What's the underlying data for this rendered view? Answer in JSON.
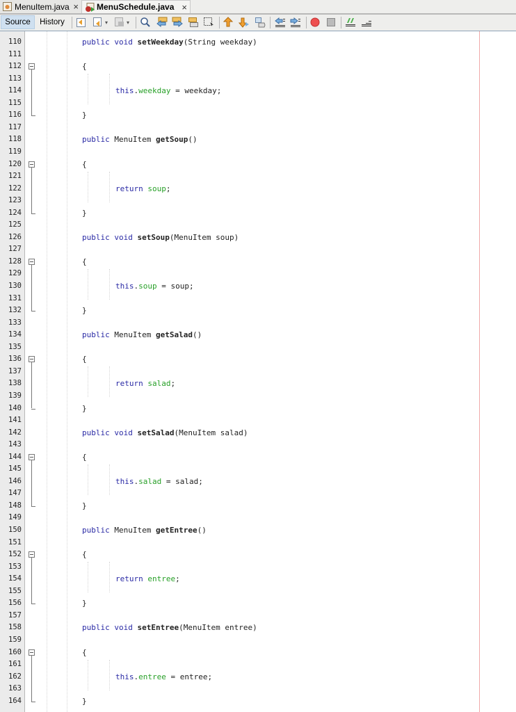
{
  "tabs": [
    {
      "label": "MenuItem.java",
      "icon": "java-file-icon",
      "close": "×",
      "active": false
    },
    {
      "label": "MenuSchedule.java",
      "icon": "java-main-file-icon",
      "close": "×",
      "active": true
    }
  ],
  "toolbar": {
    "source_label": "Source",
    "history_label": "History",
    "icons": [
      "last-edit-icon",
      "back-icon",
      "forward-icon",
      "find-selection-icon",
      "find-previous-icon",
      "find-next-icon",
      "toggle-highlight-icon",
      "toggle-rectangular-selection-icon",
      "previous-bookmark-icon",
      "next-bookmark-icon",
      "toggle-bookmark-icon",
      "shift-left-icon",
      "shift-right-icon",
      "start-macro-icon",
      "stop-macro-icon",
      "comment-icon",
      "uncomment-icon"
    ]
  },
  "colors": {
    "keyword": "#2a2aa5",
    "field": "#28a028",
    "margin_line": "#f0a9a9",
    "active_tab": "#cfe0f0"
  },
  "code": {
    "first_line": 110,
    "lines": [
      {
        "n": "110",
        "tokens": [
          [
            "kw",
            "public"
          ],
          [
            "t",
            " "
          ],
          [
            "kw",
            "void"
          ],
          [
            "t",
            " "
          ],
          [
            "m",
            "setWeekday"
          ],
          [
            "t",
            "(String weekday)"
          ]
        ]
      },
      {
        "n": "111",
        "tokens": []
      },
      {
        "n": "112",
        "tokens": [
          [
            "t",
            "{"
          ]
        ],
        "fold": "start"
      },
      {
        "n": "113",
        "tokens": []
      },
      {
        "n": "114",
        "indent": 1,
        "tokens": [
          [
            "kw",
            "this"
          ],
          [
            "t",
            "."
          ],
          [
            "f",
            "weekday"
          ],
          [
            "t",
            " = weekday;"
          ]
        ]
      },
      {
        "n": "115",
        "tokens": []
      },
      {
        "n": "116",
        "tokens": [
          [
            "t",
            "}"
          ]
        ],
        "fold": "end"
      },
      {
        "n": "117",
        "tokens": []
      },
      {
        "n": "118",
        "tokens": [
          [
            "kw",
            "public"
          ],
          [
            "t",
            " MenuItem "
          ],
          [
            "m",
            "getSoup"
          ],
          [
            "t",
            "()"
          ]
        ]
      },
      {
        "n": "119",
        "tokens": []
      },
      {
        "n": "120",
        "tokens": [
          [
            "t",
            "{"
          ]
        ],
        "fold": "start"
      },
      {
        "n": "121",
        "tokens": []
      },
      {
        "n": "122",
        "indent": 1,
        "tokens": [
          [
            "kw",
            "return"
          ],
          [
            "t",
            " "
          ],
          [
            "f",
            "soup"
          ],
          [
            "t",
            ";"
          ]
        ]
      },
      {
        "n": "123",
        "tokens": []
      },
      {
        "n": "124",
        "tokens": [
          [
            "t",
            "}"
          ]
        ],
        "fold": "end"
      },
      {
        "n": "125",
        "tokens": []
      },
      {
        "n": "126",
        "tokens": [
          [
            "kw",
            "public"
          ],
          [
            "t",
            " "
          ],
          [
            "kw",
            "void"
          ],
          [
            "t",
            " "
          ],
          [
            "m",
            "setSoup"
          ],
          [
            "t",
            "(MenuItem soup)"
          ]
        ]
      },
      {
        "n": "127",
        "tokens": []
      },
      {
        "n": "128",
        "tokens": [
          [
            "t",
            "{"
          ]
        ],
        "fold": "start"
      },
      {
        "n": "129",
        "tokens": []
      },
      {
        "n": "130",
        "indent": 1,
        "tokens": [
          [
            "kw",
            "this"
          ],
          [
            "t",
            "."
          ],
          [
            "f",
            "soup"
          ],
          [
            "t",
            " = soup;"
          ]
        ]
      },
      {
        "n": "131",
        "tokens": []
      },
      {
        "n": "132",
        "tokens": [
          [
            "t",
            "}"
          ]
        ],
        "fold": "end"
      },
      {
        "n": "133",
        "tokens": []
      },
      {
        "n": "134",
        "tokens": [
          [
            "kw",
            "public"
          ],
          [
            "t",
            " MenuItem "
          ],
          [
            "m",
            "getSalad"
          ],
          [
            "t",
            "()"
          ]
        ]
      },
      {
        "n": "135",
        "tokens": []
      },
      {
        "n": "136",
        "tokens": [
          [
            "t",
            "{"
          ]
        ],
        "fold": "start"
      },
      {
        "n": "137",
        "tokens": []
      },
      {
        "n": "138",
        "indent": 1,
        "tokens": [
          [
            "kw",
            "return"
          ],
          [
            "t",
            " "
          ],
          [
            "f",
            "salad"
          ],
          [
            "t",
            ";"
          ]
        ]
      },
      {
        "n": "139",
        "tokens": []
      },
      {
        "n": "140",
        "tokens": [
          [
            "t",
            "}"
          ]
        ],
        "fold": "end"
      },
      {
        "n": "141",
        "tokens": []
      },
      {
        "n": "142",
        "tokens": [
          [
            "kw",
            "public"
          ],
          [
            "t",
            " "
          ],
          [
            "kw",
            "void"
          ],
          [
            "t",
            " "
          ],
          [
            "m",
            "setSalad"
          ],
          [
            "t",
            "(MenuItem salad)"
          ]
        ]
      },
      {
        "n": "143",
        "tokens": []
      },
      {
        "n": "144",
        "tokens": [
          [
            "t",
            "{"
          ]
        ],
        "fold": "start"
      },
      {
        "n": "145",
        "tokens": []
      },
      {
        "n": "146",
        "indent": 1,
        "tokens": [
          [
            "kw",
            "this"
          ],
          [
            "t",
            "."
          ],
          [
            "f",
            "salad"
          ],
          [
            "t",
            " = salad;"
          ]
        ]
      },
      {
        "n": "147",
        "tokens": []
      },
      {
        "n": "148",
        "tokens": [
          [
            "t",
            "}"
          ]
        ],
        "fold": "end"
      },
      {
        "n": "149",
        "tokens": []
      },
      {
        "n": "150",
        "tokens": [
          [
            "kw",
            "public"
          ],
          [
            "t",
            " MenuItem "
          ],
          [
            "m",
            "getEntree"
          ],
          [
            "t",
            "()"
          ]
        ]
      },
      {
        "n": "151",
        "tokens": []
      },
      {
        "n": "152",
        "tokens": [
          [
            "t",
            "{"
          ]
        ],
        "fold": "start"
      },
      {
        "n": "153",
        "tokens": []
      },
      {
        "n": "154",
        "indent": 1,
        "tokens": [
          [
            "kw",
            "return"
          ],
          [
            "t",
            " "
          ],
          [
            "f",
            "entree"
          ],
          [
            "t",
            ";"
          ]
        ]
      },
      {
        "n": "155",
        "tokens": []
      },
      {
        "n": "156",
        "tokens": [
          [
            "t",
            "}"
          ]
        ],
        "fold": "end"
      },
      {
        "n": "157",
        "tokens": []
      },
      {
        "n": "158",
        "tokens": [
          [
            "kw",
            "public"
          ],
          [
            "t",
            " "
          ],
          [
            "kw",
            "void"
          ],
          [
            "t",
            " "
          ],
          [
            "m",
            "setEntree"
          ],
          [
            "t",
            "(MenuItem entree)"
          ]
        ]
      },
      {
        "n": "159",
        "tokens": []
      },
      {
        "n": "160",
        "tokens": [
          [
            "t",
            "{"
          ]
        ],
        "fold": "start"
      },
      {
        "n": "161",
        "tokens": []
      },
      {
        "n": "162",
        "indent": 1,
        "tokens": [
          [
            "kw",
            "this"
          ],
          [
            "t",
            "."
          ],
          [
            "f",
            "entree"
          ],
          [
            "t",
            " = entree;"
          ]
        ]
      },
      {
        "n": "163",
        "tokens": []
      },
      {
        "n": "164",
        "tokens": [
          [
            "t",
            "}"
          ]
        ],
        "fold": "end"
      }
    ]
  }
}
